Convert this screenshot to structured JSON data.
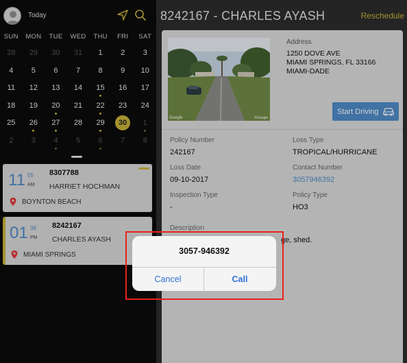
{
  "header": {
    "today_label": "Today"
  },
  "calendar": {
    "weekdays": [
      "SUN",
      "MON",
      "TUE",
      "WED",
      "THU",
      "FRI",
      "SAT"
    ],
    "weeks": [
      [
        {
          "d": "28",
          "m": true
        },
        {
          "d": "29",
          "m": true
        },
        {
          "d": "30",
          "m": true
        },
        {
          "d": "31",
          "m": true
        },
        {
          "d": "1"
        },
        {
          "d": "2"
        },
        {
          "d": "3"
        }
      ],
      [
        {
          "d": "4"
        },
        {
          "d": "5"
        },
        {
          "d": "6"
        },
        {
          "d": "7"
        },
        {
          "d": "8"
        },
        {
          "d": "9"
        },
        {
          "d": "10"
        }
      ],
      [
        {
          "d": "11"
        },
        {
          "d": "12"
        },
        {
          "d": "13"
        },
        {
          "d": "14"
        },
        {
          "d": "15",
          "dot": true
        },
        {
          "d": "16"
        },
        {
          "d": "17"
        }
      ],
      [
        {
          "d": "18"
        },
        {
          "d": "19"
        },
        {
          "d": "20",
          "dot": true
        },
        {
          "d": "21"
        },
        {
          "d": "22",
          "dot": true
        },
        {
          "d": "23"
        },
        {
          "d": "24"
        }
      ],
      [
        {
          "d": "25"
        },
        {
          "d": "26",
          "dot": true
        },
        {
          "d": "27",
          "dot": true
        },
        {
          "d": "28"
        },
        {
          "d": "29",
          "dot": true
        },
        {
          "d": "30",
          "selected": true
        },
        {
          "d": "1",
          "m": true,
          "dot": true
        }
      ],
      [
        {
          "d": "2",
          "m": true
        },
        {
          "d": "3",
          "m": true
        },
        {
          "d": "4",
          "m": true,
          "dot": true
        },
        {
          "d": "5",
          "m": true
        },
        {
          "d": "6",
          "m": true,
          "dot": true
        },
        {
          "d": "7",
          "m": true
        },
        {
          "d": "8",
          "m": true
        }
      ]
    ]
  },
  "appointments": [
    {
      "hour": "11",
      "minutes": "55",
      "ampm": "AM",
      "claim": "8307788",
      "name": "HARRIET HOCHMAN",
      "city": "BOYNTON BEACH"
    },
    {
      "hour": "01",
      "minutes": "38",
      "ampm": "PM",
      "claim": "8242167",
      "name": "CHARLES AYASH",
      "city": "MIAMI SPRINGS"
    }
  ],
  "detail": {
    "title": "8242167 -  CHARLES AYASH",
    "reschedule": "Reschedule",
    "address_label": "Address",
    "address_lines": [
      "1250 DOVE AVE",
      "MIAMI SPRINGS, FL 33166",
      "MIAMI-DADE"
    ],
    "start_driving": "Start Driving",
    "photo_watermark_left": "Google",
    "photo_watermark_right": "©Google",
    "fields": {
      "policy_number_label": "Policy Number",
      "policy_number": "242167",
      "loss_type_label": "Loss Type",
      "loss_type": "TROPICAL/HURRICANE",
      "loss_date_label": "Loss Date",
      "loss_date": "09-10-2017",
      "contact_number_label": "Contact Number",
      "contact_number": "3057946392",
      "inspection_type_label": "Inspection Type",
      "inspection_type": "-",
      "policy_type_label": "Policy Type",
      "policy_type": "HO3",
      "description_label": "Description",
      "description_visible": "ge, shed."
    }
  },
  "dialog": {
    "phone": "3057-946392",
    "cancel": "Cancel",
    "call": "Call"
  },
  "colors": {
    "accent_yellow": "#c8b33a",
    "link_blue": "#4f8bc8",
    "highlight_red": "#e8211d",
    "ios_blue": "#2f6fd6"
  }
}
